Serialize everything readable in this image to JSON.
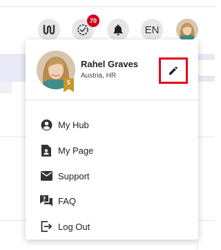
{
  "header": {
    "notification_count": "70",
    "language": "EN",
    "icons": [
      "logo-icon",
      "tasks-icon",
      "bell-icon",
      "avatar"
    ]
  },
  "profile": {
    "name": "Rahel Graves",
    "location": "Austria, HR",
    "rank_badge": "5",
    "edit_icon": "pencil-icon"
  },
  "menu": {
    "items": [
      {
        "label": "My Hub",
        "icon": "account-circle-icon"
      },
      {
        "label": "My Page",
        "icon": "badge-document-icon"
      },
      {
        "label": "Support",
        "icon": "mail-icon"
      },
      {
        "label": "FAQ",
        "icon": "faq-icon"
      },
      {
        "label": "Log Out",
        "icon": "logout-icon"
      }
    ]
  },
  "colors": {
    "accent_highlight": "#e3001b",
    "badge": "#d0021b",
    "rank_badge": "#c9962a"
  }
}
